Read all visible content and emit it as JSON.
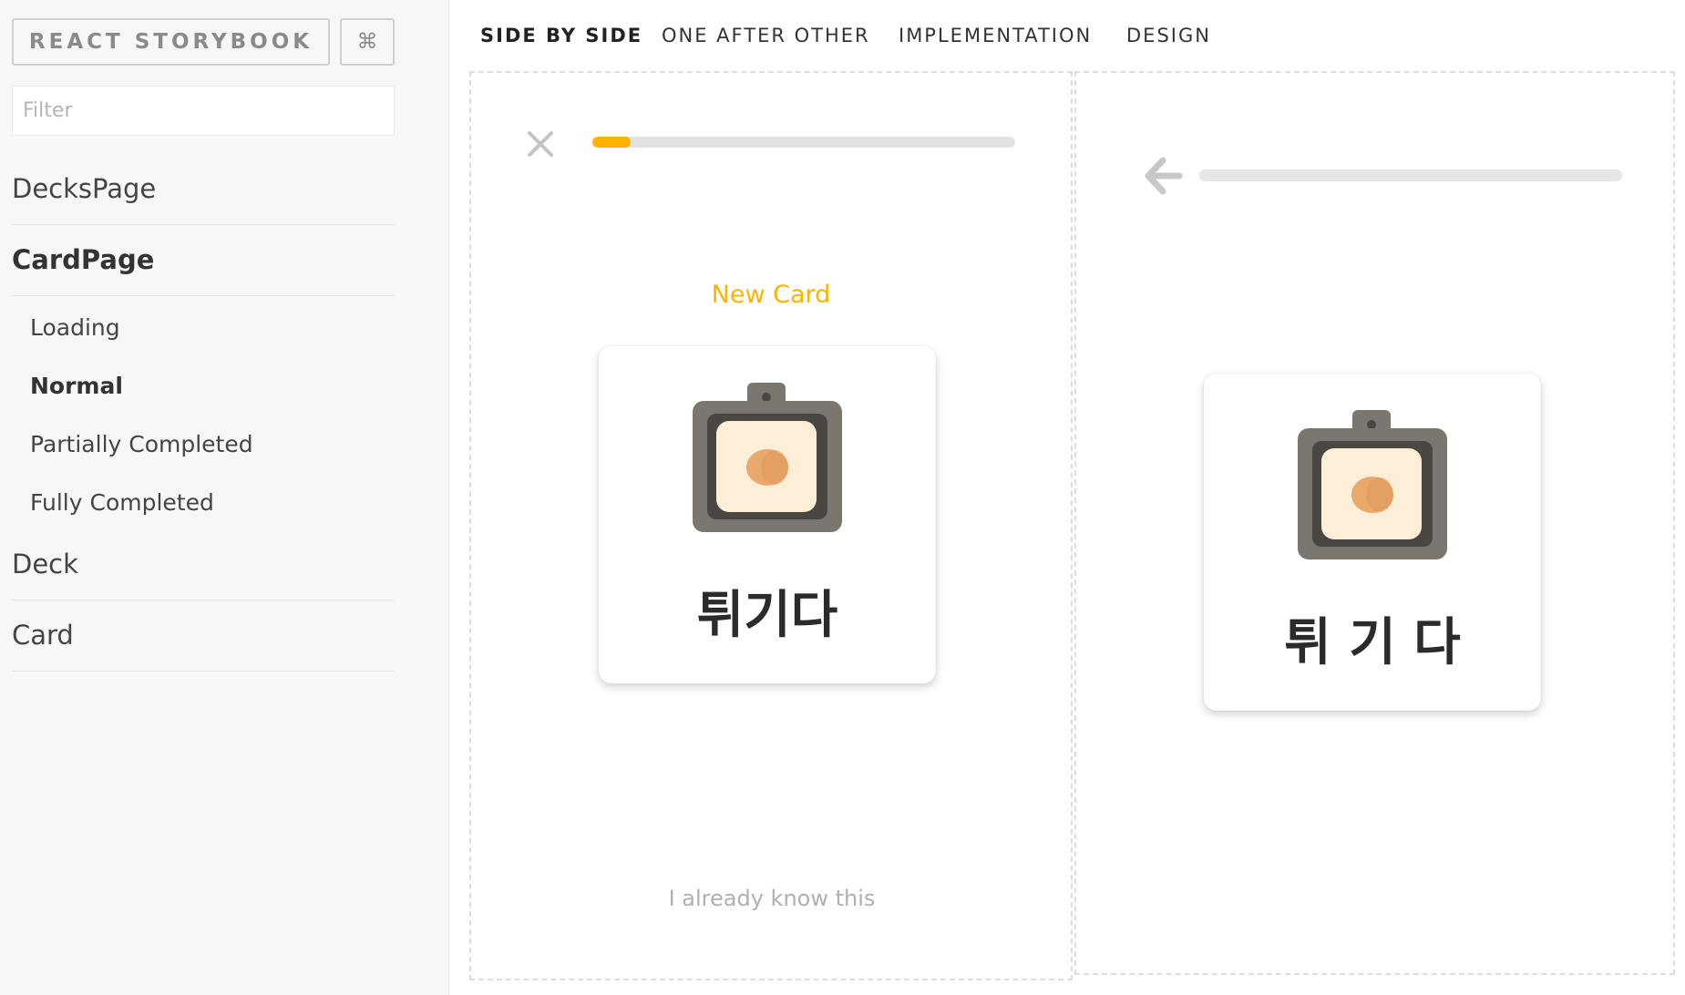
{
  "sidebar": {
    "title_button": "REACT STORYBOOK",
    "shortcut_button": "⌘",
    "filter": {
      "placeholder": "Filter",
      "value": ""
    },
    "kinds": [
      {
        "label": "DecksPage"
      },
      {
        "label": "CardPage",
        "active": true,
        "stories": [
          {
            "label": "Loading"
          },
          {
            "label": "Normal",
            "active": true
          },
          {
            "label": "Partially Completed"
          },
          {
            "label": "Fully Completed"
          }
        ]
      },
      {
        "label": "Deck"
      },
      {
        "label": "Card"
      }
    ]
  },
  "tabs": [
    {
      "label": "SIDE BY SIDE",
      "active": true
    },
    {
      "label": "ONE AFTER OTHER"
    },
    {
      "label": "IMPLEMENTATION"
    },
    {
      "label": "DESIGN"
    }
  ],
  "implementation": {
    "close_icon": "close-icon",
    "progress_fraction": 0.09,
    "status_label": "New Card",
    "card": {
      "icon": "frying-pan-icon",
      "word": "튀기다"
    },
    "know_link": "I already know this"
  },
  "design": {
    "back_icon": "arrow-left-icon",
    "card": {
      "icon": "frying-pan-icon",
      "word": "튀 기 다"
    }
  },
  "colors": {
    "accent": "#ffb300",
    "sidebar_bg": "#f7f7f7",
    "pan_frame": "#7a7670",
    "pan_inner": "#fdeed8",
    "pan_egg": "#e9a86c"
  }
}
